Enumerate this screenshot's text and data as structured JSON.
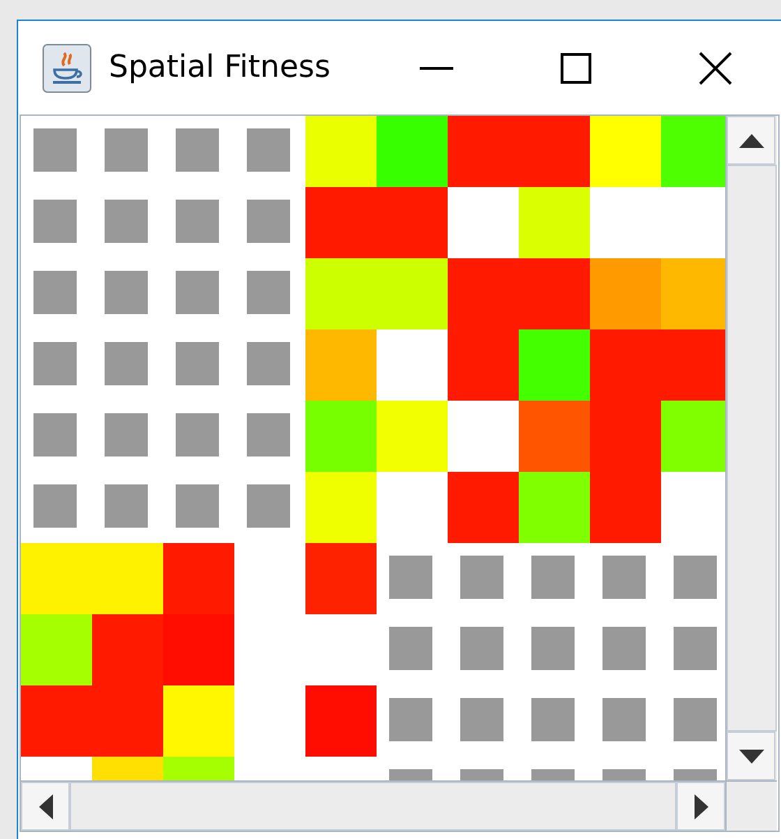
{
  "window": {
    "title": "Spatial Fitness"
  },
  "grid": {
    "rows": [
      {
        "cells": [
          {
            "kind": "marker"
          },
          {
            "kind": "marker"
          },
          {
            "kind": "marker"
          },
          {
            "kind": "marker"
          },
          {
            "kind": "fill",
            "color": "#eaff00"
          },
          {
            "kind": "fill",
            "color": "#38ff00"
          },
          {
            "kind": "fill",
            "color": "#ff1a00"
          },
          {
            "kind": "fill",
            "color": "#ff1a00"
          },
          {
            "kind": "fill",
            "color": "#ffff00"
          },
          {
            "kind": "fill",
            "color": "#4dff00"
          }
        ]
      },
      {
        "cells": [
          {
            "kind": "marker"
          },
          {
            "kind": "marker"
          },
          {
            "kind": "marker"
          },
          {
            "kind": "marker"
          },
          {
            "kind": "fill",
            "color": "#ff1a00"
          },
          {
            "kind": "fill",
            "color": "#ff1a00"
          },
          {
            "kind": "blank"
          },
          {
            "kind": "fill",
            "color": "#d9ff00"
          },
          {
            "kind": "blank"
          },
          {
            "kind": "blank"
          }
        ]
      },
      {
        "cells": [
          {
            "kind": "marker"
          },
          {
            "kind": "marker"
          },
          {
            "kind": "marker"
          },
          {
            "kind": "marker"
          },
          {
            "kind": "fill",
            "color": "#ccff00"
          },
          {
            "kind": "fill",
            "color": "#ccff00"
          },
          {
            "kind": "fill",
            "color": "#ff1a00"
          },
          {
            "kind": "fill",
            "color": "#ff1a00"
          },
          {
            "kind": "fill",
            "color": "#ff9a00"
          },
          {
            "kind": "fill",
            "color": "#ffb800"
          }
        ]
      },
      {
        "cells": [
          {
            "kind": "marker"
          },
          {
            "kind": "marker"
          },
          {
            "kind": "marker"
          },
          {
            "kind": "marker"
          },
          {
            "kind": "fill",
            "color": "#ffb800"
          },
          {
            "kind": "blank"
          },
          {
            "kind": "fill",
            "color": "#ff1a00"
          },
          {
            "kind": "fill",
            "color": "#44ff00"
          },
          {
            "kind": "fill",
            "color": "#ff1a00"
          },
          {
            "kind": "fill",
            "color": "#ff1a00"
          }
        ]
      },
      {
        "cells": [
          {
            "kind": "marker"
          },
          {
            "kind": "marker"
          },
          {
            "kind": "marker"
          },
          {
            "kind": "marker"
          },
          {
            "kind": "fill",
            "color": "#77ff00"
          },
          {
            "kind": "fill",
            "color": "#f2ff00"
          },
          {
            "kind": "blank"
          },
          {
            "kind": "fill",
            "color": "#ff5500"
          },
          {
            "kind": "fill",
            "color": "#ff1a00"
          },
          {
            "kind": "fill",
            "color": "#7fff00"
          }
        ]
      },
      {
        "cells": [
          {
            "kind": "marker"
          },
          {
            "kind": "marker"
          },
          {
            "kind": "marker"
          },
          {
            "kind": "marker"
          },
          {
            "kind": "fill",
            "color": "#f0ff00"
          },
          {
            "kind": "blank"
          },
          {
            "kind": "fill",
            "color": "#ff1a00"
          },
          {
            "kind": "fill",
            "color": "#80ff00"
          },
          {
            "kind": "fill",
            "color": "#ff1a00"
          },
          {
            "kind": "blank"
          }
        ]
      },
      {
        "cells": [
          {
            "kind": "fill",
            "color": "#fff200"
          },
          {
            "kind": "fill",
            "color": "#fff200"
          },
          {
            "kind": "fill",
            "color": "#ff1a00"
          },
          {
            "kind": "blank"
          },
          {
            "kind": "fill",
            "color": "#ff2200"
          },
          {
            "kind": "marker"
          },
          {
            "kind": "marker"
          },
          {
            "kind": "marker"
          },
          {
            "kind": "marker"
          },
          {
            "kind": "marker"
          }
        ]
      },
      {
        "cells": [
          {
            "kind": "fill",
            "color": "#a6ff00"
          },
          {
            "kind": "fill",
            "color": "#ff1a00"
          },
          {
            "kind": "fill",
            "color": "#ff0d00"
          },
          {
            "kind": "blank"
          },
          {
            "kind": "blank"
          },
          {
            "kind": "marker"
          },
          {
            "kind": "marker"
          },
          {
            "kind": "marker"
          },
          {
            "kind": "marker"
          },
          {
            "kind": "marker"
          }
        ]
      },
      {
        "cells": [
          {
            "kind": "fill",
            "color": "#ff1a00"
          },
          {
            "kind": "fill",
            "color": "#ff1a00"
          },
          {
            "kind": "fill",
            "color": "#fff700"
          },
          {
            "kind": "blank"
          },
          {
            "kind": "fill",
            "color": "#ff0d00"
          },
          {
            "kind": "marker"
          },
          {
            "kind": "marker"
          },
          {
            "kind": "marker"
          },
          {
            "kind": "marker"
          },
          {
            "kind": "marker"
          }
        ]
      },
      {
        "cells": [
          {
            "kind": "blank"
          },
          {
            "kind": "fill",
            "color": "#ffe000"
          },
          {
            "kind": "fill",
            "color": "#a6ff00"
          },
          {
            "kind": "blank"
          },
          {
            "kind": "blank"
          },
          {
            "kind": "marker"
          },
          {
            "kind": "marker"
          },
          {
            "kind": "marker"
          },
          {
            "kind": "marker"
          },
          {
            "kind": "marker"
          }
        ]
      }
    ]
  }
}
